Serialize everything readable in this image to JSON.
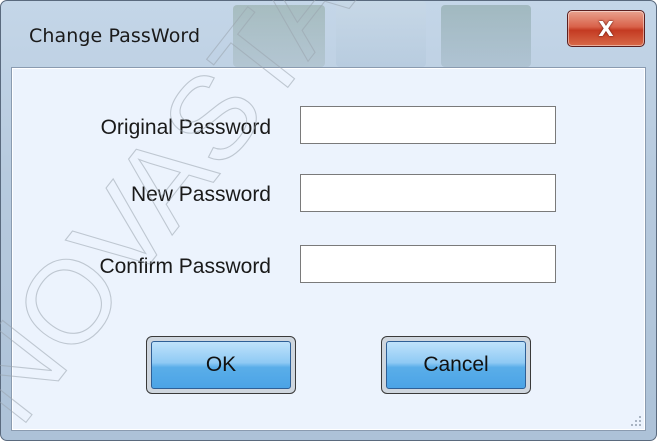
{
  "window": {
    "title": "Change PassWord",
    "close_glyph": "X",
    "close_icon": "close-icon"
  },
  "form": {
    "fields": [
      {
        "label": "Original Password",
        "value": "",
        "placeholder": ""
      },
      {
        "label": "New Password",
        "value": "",
        "placeholder": ""
      },
      {
        "label": "Confirm Password",
        "value": "",
        "placeholder": ""
      }
    ]
  },
  "buttons": {
    "ok_label": "OK",
    "cancel_label": "Cancel"
  },
  "watermark": {
    "text": "NOVASTAR TECH"
  },
  "colors": {
    "titlebar": "#b7cade",
    "client_background": "#ecf3fd",
    "close_button": "#c43a22",
    "button_face": "#5aaee9"
  }
}
